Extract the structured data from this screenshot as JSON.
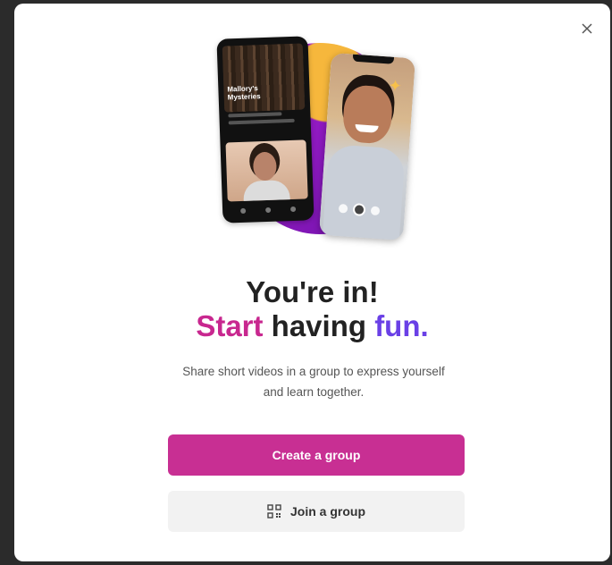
{
  "dialog": {
    "close_icon": "close-icon",
    "heading_line1": "You're in!",
    "heading_word_pink": "Start",
    "heading_word_middle": " having ",
    "heading_word_purple": "fun.",
    "subtitle": "Share short videos in a group to express yourself and learn together.",
    "primary_button": "Create a group",
    "secondary_button": "Join a group",
    "secondary_button_icon": "qr-code-icon"
  },
  "illustration": {
    "left_phone_title": "Mallory's Mysteries"
  },
  "colors": {
    "accent_pink": "#c8278f",
    "accent_purple": "#6a40e6",
    "primary_button": "#c82f93",
    "secondary_button": "#f2f2f2"
  }
}
